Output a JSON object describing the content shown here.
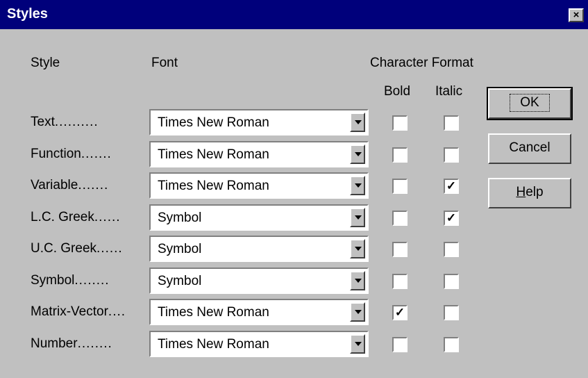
{
  "window": {
    "title": "Styles",
    "close_glyph": "×"
  },
  "headers": {
    "style": "Style",
    "font": "Font",
    "character_format": "Character Format",
    "bold": "Bold",
    "italic": "Italic"
  },
  "rows": [
    {
      "label": "Text",
      "dots": "..........",
      "font": "Times New Roman",
      "bold": false,
      "italic": false
    },
    {
      "label": "Function",
      "dots": ".......",
      "font": "Times New Roman",
      "bold": false,
      "italic": false
    },
    {
      "label": "Variable",
      "dots": ".......",
      "font": "Times New Roman",
      "bold": false,
      "italic": true
    },
    {
      "label": "L.C. Greek",
      "dots": "......",
      "font": "Symbol",
      "bold": false,
      "italic": true
    },
    {
      "label": "U.C. Greek",
      "dots": "......",
      "font": "Symbol",
      "bold": false,
      "italic": false
    },
    {
      "label": "Symbol",
      "dots": "........",
      "font": "Symbol",
      "bold": false,
      "italic": false
    },
    {
      "label": "Matrix-Vector",
      "dots": "....",
      "font": "Times New Roman",
      "bold": true,
      "italic": false
    },
    {
      "label": "Number",
      "dots": "........",
      "font": "Times New Roman",
      "bold": false,
      "italic": false
    }
  ],
  "buttons": {
    "ok": "OK",
    "cancel": "Cancel",
    "help_prefix": "H",
    "help_rest": "elp"
  },
  "check_glyph": "✓",
  "colors": {
    "title_bar": "#00007b",
    "face": "#c0c0c0"
  }
}
